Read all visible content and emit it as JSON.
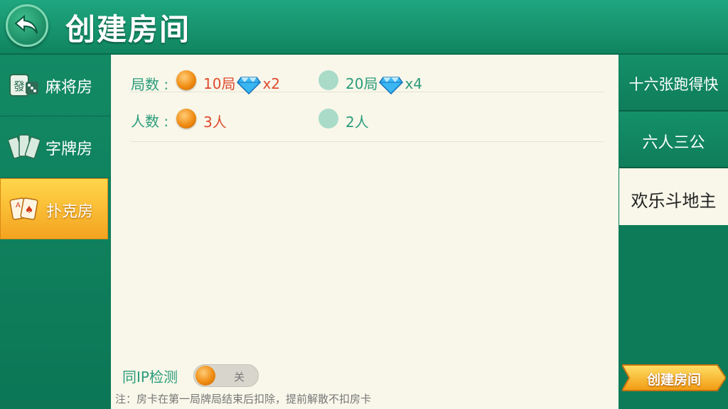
{
  "header": {
    "title": "创建房间"
  },
  "sidebar": {
    "items": [
      {
        "label": "麻将房",
        "icon": "mahjong-tile-icon"
      },
      {
        "label": "字牌房",
        "icon": "paper-cards-icon"
      },
      {
        "label": "扑克房",
        "icon": "poker-cards-icon",
        "active": true
      }
    ]
  },
  "main": {
    "rounds": {
      "label": "局数 :",
      "options": [
        {
          "text": "10局",
          "cost": "x2",
          "selected": true
        },
        {
          "text": "20局",
          "cost": "x4",
          "selected": false
        }
      ]
    },
    "players": {
      "label": "人数 :",
      "options": [
        {
          "text": "3人",
          "selected": true
        },
        {
          "text": "2人",
          "selected": false
        }
      ]
    },
    "ip_check": {
      "label": "同IP检测",
      "state": "关"
    },
    "note": "注：房卡在第一局牌局结束后扣除，提前解散不扣房卡"
  },
  "game_types": [
    {
      "label": "十六张跑得快"
    },
    {
      "label": "六人三公"
    },
    {
      "label": "欢乐斗地主",
      "active": true
    }
  ],
  "create_button": {
    "label": "创建房间"
  },
  "colors": {
    "green": "#2b9c7b",
    "red": "#e04a2e",
    "orange": "#f08c12",
    "panel": "#f8f7ea",
    "header": "#1fa67f"
  }
}
